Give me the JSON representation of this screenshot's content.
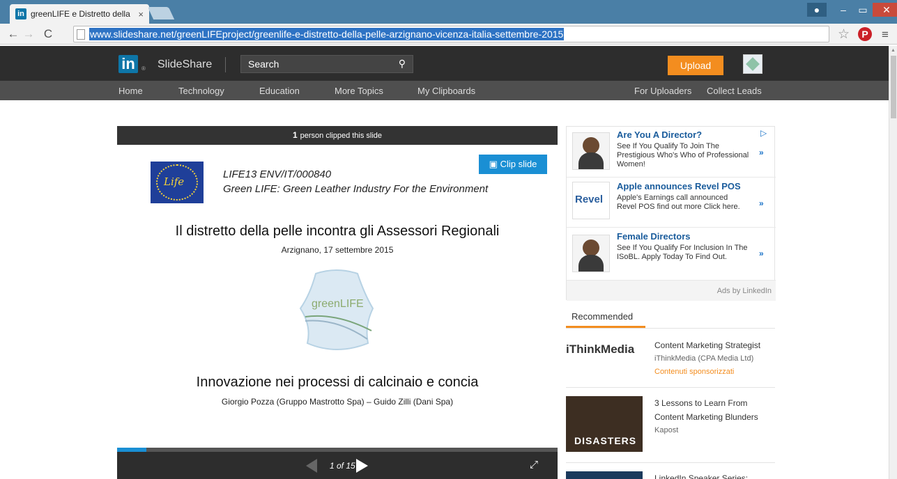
{
  "browser": {
    "tab_title": "greenLIFE e Distretto della",
    "tab_close": "×",
    "favicon": "in",
    "url": "www.slideshare.net/greenLIFEproject/greenlife-e-distretto-della-pelle-arzignano-vicenza-italia-settembre-2015",
    "icons": [
      "back-icon",
      "forward-icon",
      "reload-icon",
      "page-icon",
      "star-icon",
      "pinterest-icon",
      "menu-icon"
    ]
  },
  "header": {
    "logo_in": "in",
    "logo_mark": "®",
    "logo_text": "SlideShare",
    "search_placeholder": "Search",
    "upload_label": "Upload"
  },
  "nav": {
    "left": [
      "Home",
      "Technology",
      "Education",
      "More Topics",
      "My Clipboards"
    ],
    "right": [
      "For Uploaders",
      "Collect Leads"
    ]
  },
  "viewer": {
    "clip_count": "1",
    "clip_text": "person clipped this slide",
    "clip_button": "Clip slide",
    "slide": {
      "flag_text": "Life",
      "project_code": "LIFE13 ENV/IT/000840",
      "project_name": "Green LIFE: Green Leather Industry For the Environment",
      "title": "Il distretto della pelle incontra gli Assessori Regionali",
      "date": "Arzignano, 17 settembre 2015",
      "logo_text": "greenLIFE",
      "subtitle": "Innovazione nei processi di calcinaio e concia",
      "authors": "Giorgio Pozza (Gruppo Mastrotto Spa) – Guido Zilli (Dani Spa)"
    },
    "progress": 0.067,
    "pager": "1 of 15"
  },
  "ads": {
    "items": [
      {
        "title": "Are You A Director?",
        "body": "See If You Qualify To Join The Prestigious Who's Who of Professional Women!"
      },
      {
        "title": "Apple announces Revel POS",
        "body": "Apple's Earnings call announced Revel POS find out more Click here."
      },
      {
        "title": "Female Directors",
        "body": "See If You Qualify For Inclusion In The ISoBL. Apply Today To Find Out."
      }
    ],
    "revel_logo": "Revel",
    "arrow": "»",
    "footer": "Ads by LinkedIn"
  },
  "recommended": {
    "heading": "Recommended",
    "items": [
      {
        "title": "Content Marketing Strategist",
        "source": "iThinkMedia (CPA Media Ltd)",
        "sponsored": "Contenuti sponsorizzati",
        "thumb_text": "iThinkMedia"
      },
      {
        "title": "3 Lessons to Learn From Content Marketing Blunders",
        "source": "Kapost",
        "thumb_text": "DISASTERS"
      },
      {
        "title": "LinkedIn Speaker Series:"
      }
    ]
  },
  "colors": {
    "accent_orange": "#f38d1f",
    "linkedin_blue": "#0e76a8",
    "clip_blue": "#1a8fd4",
    "header_dark": "#2d2d2d"
  }
}
